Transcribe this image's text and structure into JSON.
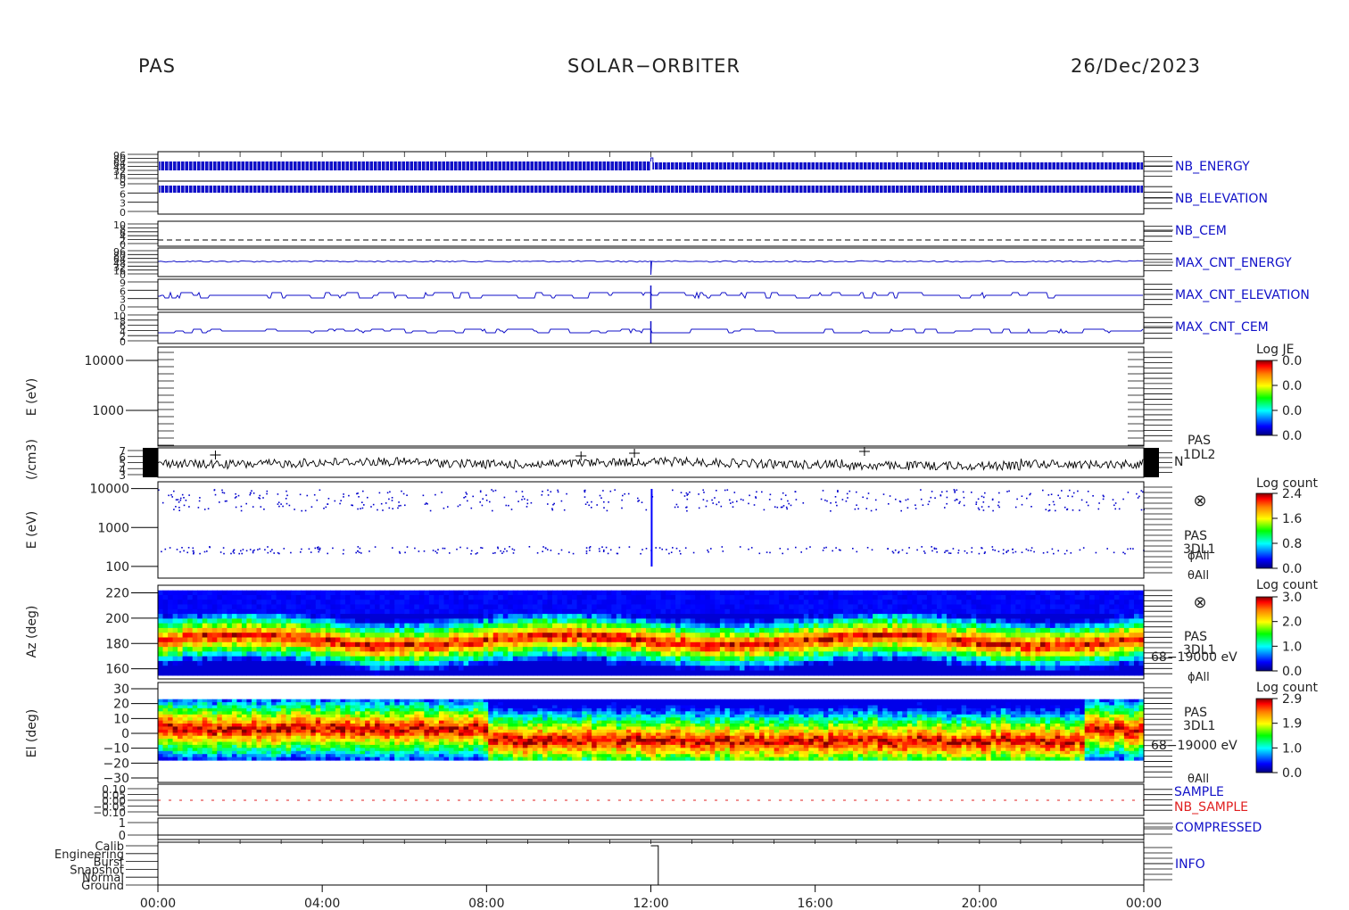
{
  "header": {
    "instrument": "PAS",
    "mission": "SOLAR−ORBITER",
    "date": "26/Dec/2023"
  },
  "colors": {
    "hk_blue": "#1010c8",
    "nb_sample_red": "#e02020",
    "data_black": "#000000",
    "spectrogram_scale": [
      "#00007f",
      "#0000ff",
      "#00ffff",
      "#00ff00",
      "#ffff00",
      "#ff7f00",
      "#ff0000",
      "#7f0000"
    ]
  },
  "chart_data": {
    "type": "heatmap",
    "x_axis": {
      "ticks": [
        "00:00",
        "04:00",
        "08:00",
        "12:00",
        "16:00",
        "20:00",
        "00:00"
      ],
      "range_hours": [
        0,
        24
      ]
    },
    "panels": [
      {
        "id": "nb_energy",
        "label": "NB_ENERGY",
        "type": "line",
        "tick_labels": [
          "96",
          "80",
          "64",
          "48",
          "32",
          "16",
          "0"
        ]
      },
      {
        "id": "nb_elevation",
        "label": "NB_ELEVATION",
        "type": "line",
        "tick_labels": [
          "9",
          "6",
          "3",
          "0"
        ]
      },
      {
        "id": "nb_cem",
        "label": "NB_CEM",
        "type": "line",
        "tick_labels": [
          "10",
          "8",
          "6",
          "4",
          "2",
          "0"
        ]
      },
      {
        "id": "max_cnt_energy",
        "label": "MAX_CNT_ENERGY",
        "type": "line",
        "tick_labels": [
          "96",
          "80",
          "64",
          "48",
          "32",
          "16",
          "0"
        ]
      },
      {
        "id": "max_cnt_elevation",
        "label": "MAX_CNT_ELEVATION",
        "type": "line",
        "tick_labels": [
          "9",
          "6",
          "3",
          "0"
        ]
      },
      {
        "id": "max_cnt_cem",
        "label": "MAX_CNT_CEM",
        "type": "line",
        "tick_labels": [
          "10",
          "8",
          "6",
          "4",
          "2",
          "0"
        ]
      },
      {
        "id": "l1_energy_empty",
        "ylabel": "E (eV)",
        "type": "heatmap",
        "y_scale": "log",
        "tick_labels": [
          "10000",
          "1000"
        ],
        "colorbar_title": "Log JE",
        "colorbar_ticks": [
          "0.0",
          "0.0",
          "0.0",
          "0.0"
        ]
      },
      {
        "id": "density",
        "ylabel": "(/cm3)",
        "type": "line",
        "tick_labels": [
          "7",
          "6",
          "5",
          "4",
          "3"
        ],
        "right_labels": [
          "PAS",
          "1DL2",
          "N"
        ]
      },
      {
        "id": "energy_spectrogram",
        "ylabel": "E (eV)",
        "type": "heatmap",
        "y_scale": "log",
        "ylim": [
          50,
          15000
        ],
        "tick_labels": [
          "10000",
          "1000",
          "100"
        ],
        "colorbar_title": "Log count",
        "colorbar_ticks": [
          "2.4",
          "1.6",
          "0.8",
          "0.0"
        ],
        "right_labels": [
          "⊗",
          "PAS",
          "3DL1",
          "ϕAll",
          "θAll"
        ]
      },
      {
        "id": "azimuth_spectrogram",
        "ylabel": "Az (deg)",
        "type": "heatmap",
        "ylim": [
          152,
          226
        ],
        "tick_labels": [
          "220",
          "200",
          "180",
          "160"
        ],
        "colorbar_title": "Log count",
        "colorbar_ticks": [
          "3.0",
          "2.0",
          "1.0",
          "0.0"
        ],
        "right_labels": [
          "⊗",
          "PAS",
          "3DL1",
          "68−19000 eV",
          "ϕAll"
        ]
      },
      {
        "id": "elevation_spectrogram",
        "ylabel": "El (deg)",
        "type": "heatmap",
        "ylim": [
          -30,
          30
        ],
        "tick_labels": [
          "30",
          "20",
          "10",
          "0",
          "−10",
          "−20",
          "−30"
        ],
        "colorbar_title": "Log count",
        "colorbar_ticks": [
          "2.9",
          "1.9",
          "1.0",
          "0.0"
        ],
        "right_labels": [
          "PAS",
          "3DL1",
          "68−19000 eV",
          "θAll"
        ]
      },
      {
        "id": "sample",
        "labels": [
          "SAMPLE",
          "NB_SAMPLE"
        ],
        "type": "line",
        "tick_labels": [
          "0.10",
          "0.05",
          "0.00",
          "−0.05",
          "−0.10"
        ]
      },
      {
        "id": "compressed",
        "label": "COMPRESSED",
        "type": "line",
        "tick_labels": [
          "1",
          "0"
        ]
      },
      {
        "id": "info",
        "label": "INFO",
        "type": "step",
        "tick_labels": [
          "Calib",
          "Engineering",
          "Burst",
          "Snapshot",
          "Normal",
          "Ground"
        ],
        "states": [
          {
            "from_hour": 0,
            "to_hour": 12.0,
            "state": "Calib"
          },
          {
            "from_hour": 12.0,
            "to_hour": 24,
            "state": "Ground"
          }
        ]
      }
    ]
  }
}
